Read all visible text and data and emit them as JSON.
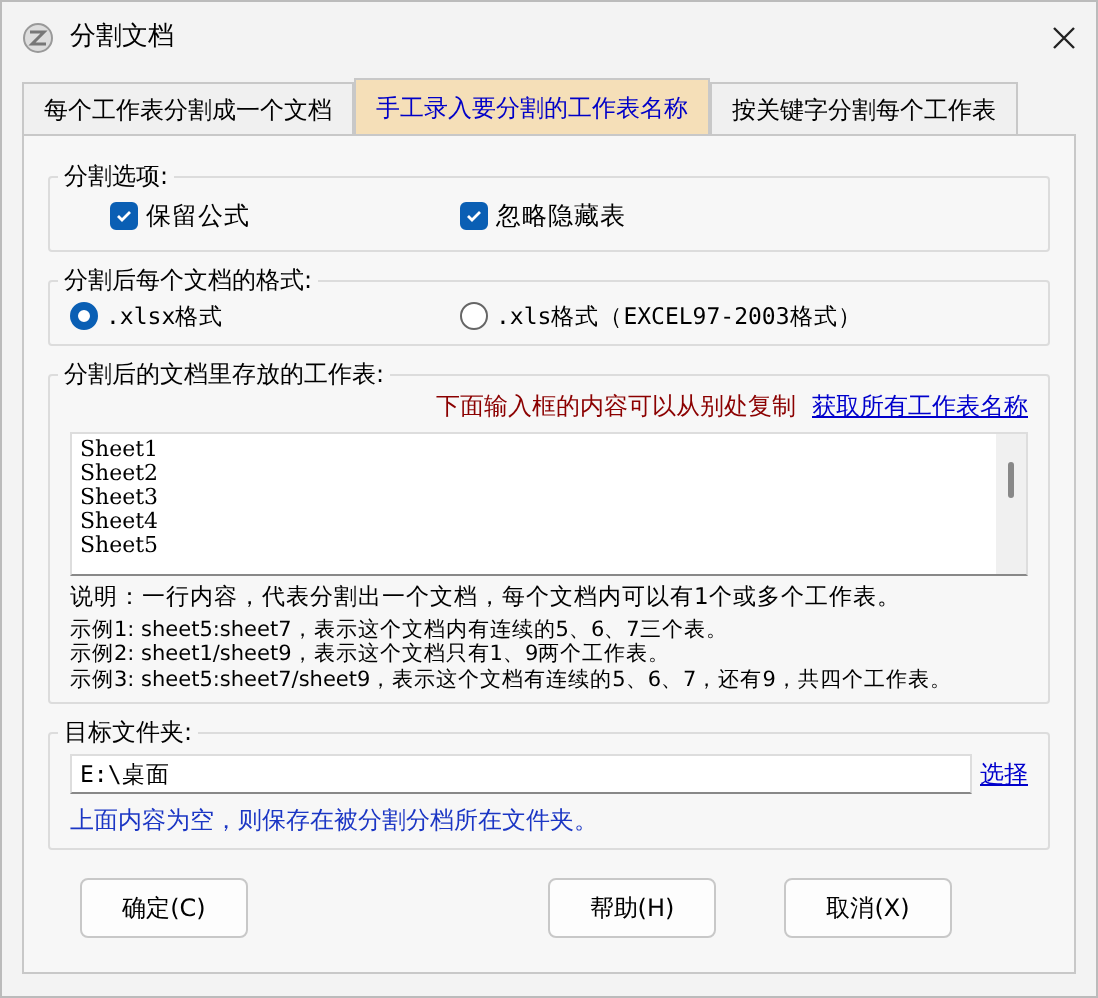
{
  "window": {
    "title": "分割文档"
  },
  "tabs": [
    {
      "label": "每个工作表分割成一个文档",
      "selected": false
    },
    {
      "label": "手工录入要分割的工作表名称",
      "selected": true
    },
    {
      "label": "按关键字分割每个工作表",
      "selected": false
    }
  ],
  "split_options": {
    "legend": "分割选项:",
    "checkboxes": [
      {
        "label": "保留公式",
        "checked": true
      },
      {
        "label": "忽略隐藏表",
        "checked": true
      }
    ]
  },
  "output_format": {
    "legend": "分割后每个文档的格式:",
    "radios": [
      {
        "label": ".xlsx格式",
        "selected": true
      },
      {
        "label": ".xls格式（EXCEL97-2003格式）",
        "selected": false
      }
    ]
  },
  "sheets": {
    "legend": "分割后的文档里存放的工作表:",
    "hint": "下面输入框的内容可以从别处复制",
    "link": "获取所有工作表名称",
    "lines": [
      "Sheet1",
      "Sheet2",
      "Sheet3",
      "Sheet4",
      "Sheet5"
    ],
    "notes": [
      "说明：一行内容，代表分割出一个文档，每个文档内可以有1个或多个工作表。",
      "示例1: sheet5:sheet7，表示这个文档内有连续的5、6、7三个表。",
      "示例2: sheet1/sheet9，表示这个文档只有1、9两个工作表。",
      "示例3: sheet5:sheet7/sheet9，表示这个文档有连续的5、6、7，还有9，共四个工作表。"
    ]
  },
  "target_folder": {
    "legend": "目标文件夹:",
    "value": "E:\\桌面",
    "link": "选择",
    "hint": "上面内容为空，则保存在被分割分档所在文件夹。"
  },
  "buttons": [
    "确定(C)",
    "帮助(H)",
    "取消(X)"
  ]
}
